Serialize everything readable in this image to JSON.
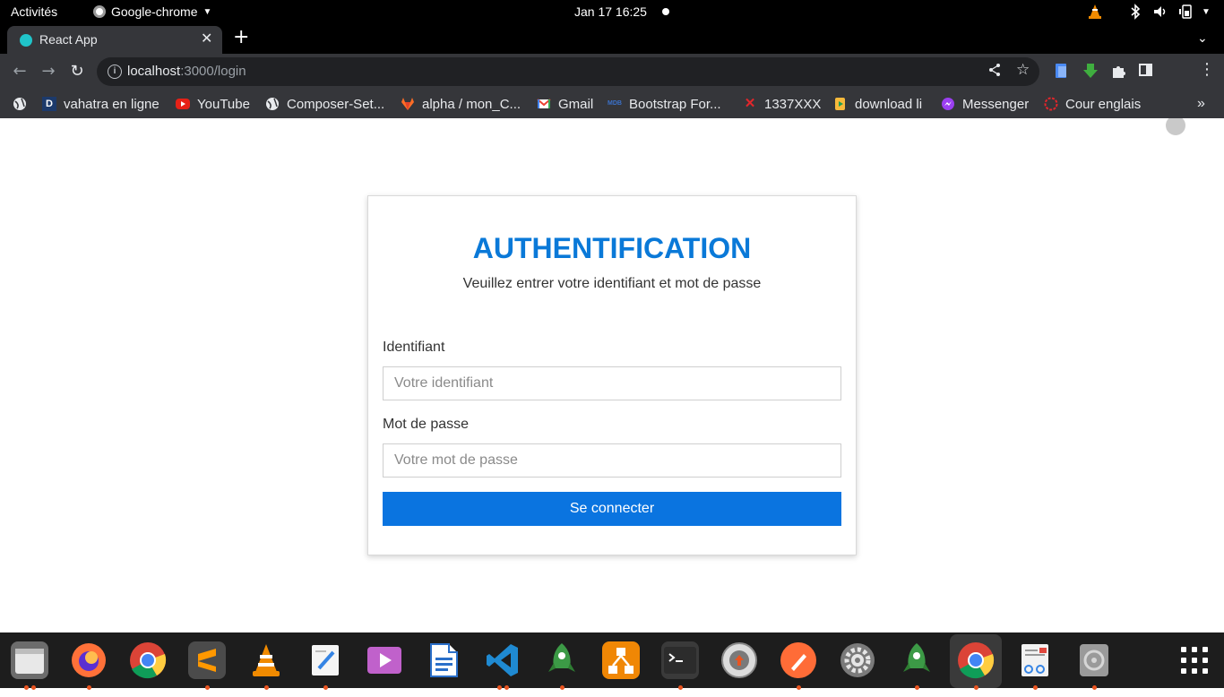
{
  "topbar": {
    "activities": "Activités",
    "app_name": "Google-chrome",
    "clock": "Jan 17  16:25"
  },
  "browser": {
    "tab_title": "React App",
    "url_host": "localhost",
    "url_path": ":3000/login"
  },
  "bookmarks": [
    {
      "label": "vahatra en ligne",
      "icon": "letter-d-icon"
    },
    {
      "label": "YouTube",
      "icon": "youtube-icon"
    },
    {
      "label": "Composer-Set...",
      "icon": "globe-icon"
    },
    {
      "label": "alpha / mon_C...",
      "icon": "gitlab-icon"
    },
    {
      "label": "Gmail",
      "icon": "gmail-icon"
    },
    {
      "label": "Bootstrap For...",
      "icon": "mdb-icon"
    },
    {
      "label": "1337XXX",
      "icon": "red-x-icon"
    },
    {
      "label": "download li",
      "icon": "download-icon"
    },
    {
      "label": "Messenger",
      "icon": "messenger-icon"
    },
    {
      "label": "Cour englais",
      "icon": "red-circle-icon"
    }
  ],
  "login": {
    "title": "AUTHENTIFICATION",
    "subtitle": "Veuillez entrer votre identifiant et mot de passe",
    "username_label": "Identifiant",
    "username_placeholder": "Votre identifiant",
    "password_label": "Mot de passe",
    "password_placeholder": "Votre mot de passe",
    "submit_label": "Se connecter"
  },
  "colors": {
    "heading": "#0a79d8",
    "button": "#0a74e0",
    "chrome_dark": "#35363a"
  },
  "dock": [
    "files",
    "firefox",
    "chrome",
    "sublime-text",
    "vlc",
    "text-editor",
    "video-player",
    "libreoffice-writer",
    "vscode",
    "rocket-app",
    "draw-io",
    "terminal",
    "software-updater",
    "postman",
    "settings",
    "rocket-app-2",
    "chrome-active",
    "document-viewer",
    "disk-utility"
  ]
}
